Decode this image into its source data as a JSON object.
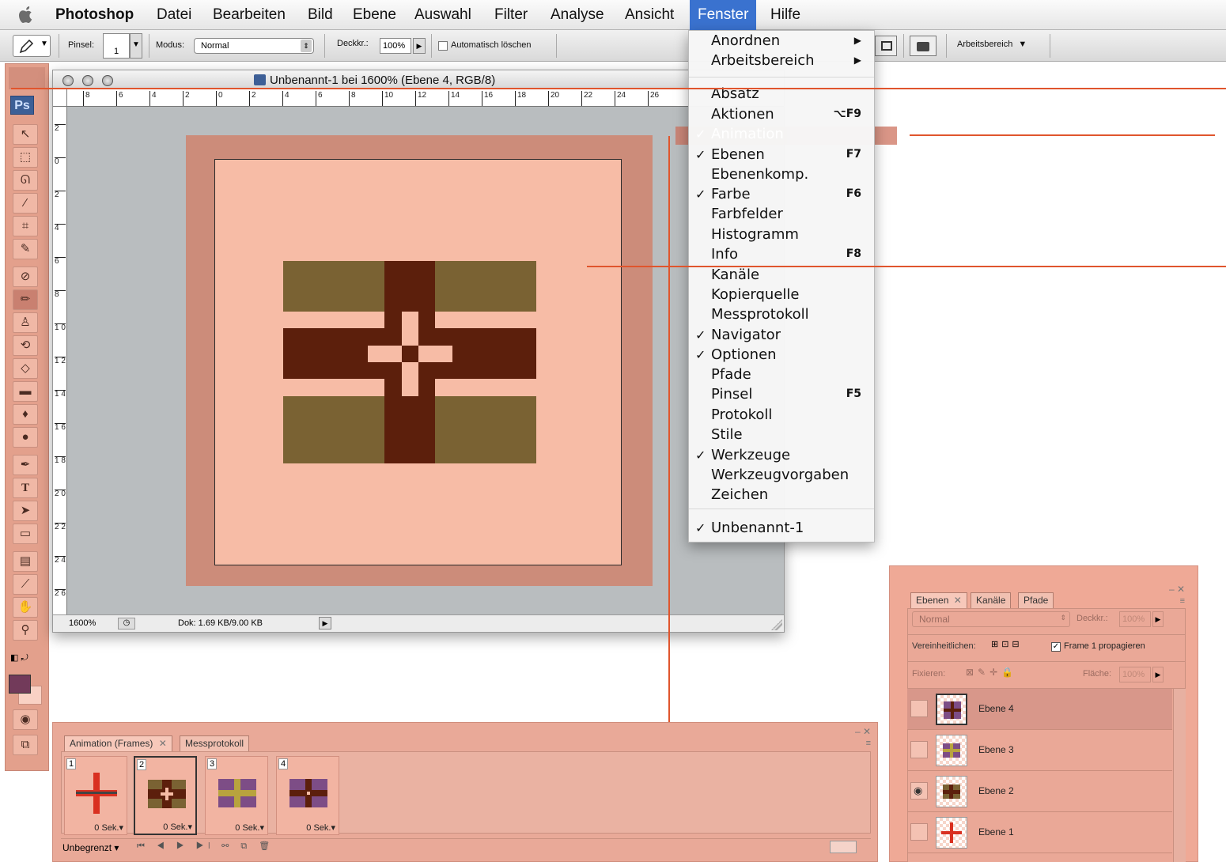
{
  "menubar": {
    "items": [
      "Photoshop",
      "Datei",
      "Bearbeiten",
      "Bild",
      "Ebene",
      "Auswahl",
      "Filter",
      "Analyse",
      "Ansicht",
      "Fenster",
      "Hilfe"
    ],
    "active": "Fenster"
  },
  "options_bar": {
    "pinsel_label": "Pinsel:",
    "brush_size": "1",
    "modus_label": "Modus:",
    "modus_value": "Normal",
    "deckkraft_label": "Deckkr.:",
    "deckkraft_value": "100%",
    "auto_erase_label": "Automatisch löschen",
    "workspace_label": "Arbeitsbereich"
  },
  "toolbox": {
    "logo": "Ps"
  },
  "document": {
    "title": "Unbenannt-1 bei 1600% (Ebene 4, RGB/8)",
    "zoom": "1600%",
    "doc_info": "Dok: 1.69 KB/9.00 KB",
    "ruler_h": [
      "8",
      "6",
      "4",
      "2",
      "0",
      "2",
      "4",
      "6",
      "8",
      "10",
      "12",
      "14",
      "16",
      "18",
      "20",
      "22",
      "24",
      "26"
    ],
    "ruler_v": [
      "2",
      "0",
      "2",
      "4",
      "6",
      "8",
      "1 0",
      "1 2",
      "1 4",
      "1 6",
      "1 8",
      "2 0",
      "2 2",
      "2 4",
      "2 6"
    ]
  },
  "fenster_menu": {
    "items": [
      {
        "label": "Anordnen",
        "submenu": "▶"
      },
      {
        "label": "Arbeitsbereich",
        "submenu": "▶"
      },
      {
        "label": "Absatz"
      },
      {
        "label": "Aktionen",
        "shortcut": "⌥F9"
      },
      {
        "label": "Animation",
        "checked": "✓"
      },
      {
        "label": "Ebenen",
        "checked": "✓",
        "shortcut": "F7"
      },
      {
        "label": "Ebenenkomp."
      },
      {
        "label": "Farbe",
        "checked": "✓",
        "shortcut": "F6"
      },
      {
        "label": "Farbfelder"
      },
      {
        "label": "Histogramm"
      },
      {
        "label": "Info",
        "shortcut": "F8"
      },
      {
        "label": "Kanäle"
      },
      {
        "label": "Kopierquelle"
      },
      {
        "label": "Messprotokoll"
      },
      {
        "label": "Navigator",
        "checked": "✓"
      },
      {
        "label": "Optionen",
        "checked": "✓"
      },
      {
        "label": "Pfade"
      },
      {
        "label": "Pinsel",
        "shortcut": "F5"
      },
      {
        "label": "Protokoll"
      },
      {
        "label": "Stile"
      },
      {
        "label": "Werkzeuge",
        "checked": "✓"
      },
      {
        "label": "Werkzeugvorgaben"
      },
      {
        "label": "Zeichen"
      },
      {
        "label": "Unbenannt-1",
        "checked": "✓"
      }
    ]
  },
  "animation_panel": {
    "tabs": [
      "Animation (Frames)",
      "Messprotokoll"
    ],
    "frames": [
      {
        "number": "1",
        "delay": "0 Sek."
      },
      {
        "number": "2",
        "delay": "0 Sek."
      },
      {
        "number": "3",
        "delay": "0 Sek."
      },
      {
        "number": "4",
        "delay": "0 Sek."
      }
    ],
    "loop": "Unbegrenzt"
  },
  "layers_panel": {
    "tabs": [
      "Ebenen",
      "Kanäle",
      "Pfade"
    ],
    "blend_mode": "Normal",
    "deckkraft_label": "Deckkr.:",
    "deckkraft_value": "100%",
    "unify_label": "Vereinheitlichen:",
    "propagate_label": "Frame 1 propagieren",
    "lock_label": "Fixieren:",
    "fill_label": "Fläche:",
    "fill_value": "100%",
    "layers": [
      "Ebene 4",
      "Ebene 3",
      "Ebene 2",
      "Ebene 1"
    ]
  },
  "colors": {
    "accent_orange": "#e0552d",
    "canvas_bg": "#f7bca6",
    "canvas_border": "#cc8c7a",
    "olive": "#7a6233",
    "dark_brown": "#5c1f0c",
    "panel_tint": "#e9a998",
    "menu_selected": "#3a72cf"
  }
}
